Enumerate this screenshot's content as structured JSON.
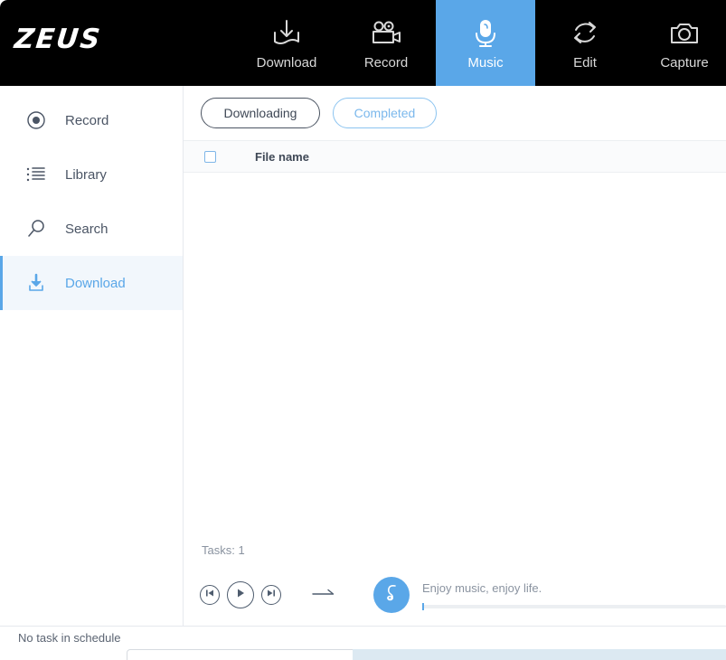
{
  "app": {
    "logo": "ZEUS"
  },
  "topnav": {
    "items": [
      {
        "label": "Download",
        "icon": "download-tray-icon",
        "active": false
      },
      {
        "label": "Record",
        "icon": "video-camera-icon",
        "active": false
      },
      {
        "label": "Music",
        "icon": "microphone-icon",
        "active": true
      },
      {
        "label": "Edit",
        "icon": "refresh-cycle-icon",
        "active": false
      },
      {
        "label": "Capture",
        "icon": "camera-icon",
        "active": false
      }
    ],
    "active_bg": "#5aa7e8",
    "bar_bg": "#000000"
  },
  "sidebar": {
    "items": [
      {
        "label": "Record",
        "icon": "record-dot-icon",
        "active": false
      },
      {
        "label": "Library",
        "icon": "list-icon",
        "active": false
      },
      {
        "label": "Search",
        "icon": "magnifier-icon",
        "active": false
      },
      {
        "label": "Download",
        "icon": "download-arrow-icon",
        "active": true
      }
    ],
    "active_color": "#5aa7e8",
    "active_bg": "#f2f7fc"
  },
  "main": {
    "tabs": [
      {
        "label": "Downloading",
        "selected": true
      },
      {
        "label": "Completed",
        "selected": false
      }
    ],
    "list": {
      "select_all_checked": false,
      "columns": [
        "File name"
      ],
      "rows": []
    },
    "tasks_label": "Tasks: 1"
  },
  "player": {
    "controls": [
      {
        "name": "previous-track",
        "icon": "skip-back-icon"
      },
      {
        "name": "play",
        "icon": "play-icon"
      },
      {
        "name": "next-track",
        "icon": "skip-forward-icon"
      }
    ],
    "play_mode_icon": "arrow-right-icon",
    "album_icon": "music-note-icon",
    "track_title": "Enjoy music, enjoy life.",
    "progress_percent": 0,
    "accent": "#5aa7e8"
  },
  "statusbar": {
    "message": "No task in schedule"
  }
}
